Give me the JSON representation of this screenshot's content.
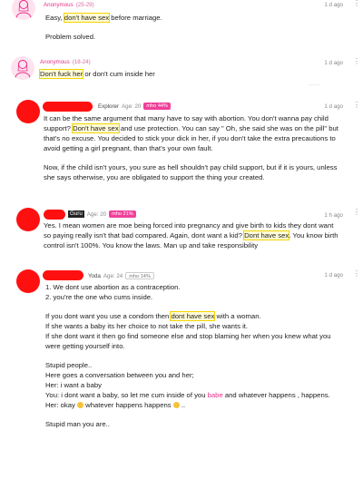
{
  "comments": [
    {
      "author": "Anonymous",
      "age": "(25-29)",
      "time": "1 d ago",
      "line1_pre": "Easy, ",
      "line1_hl": "don't have sex",
      "line1_post": " before marriage.",
      "line2": "Problem solved."
    },
    {
      "author": "Anonymous",
      "age": "(18-24)",
      "time": "1 d ago",
      "line1_hl": "Don't fuck her",
      "line1_post": " or don't cum inside her"
    },
    {
      "rank": "Explorer",
      "age": "Age: 20",
      "badge": "mho 44%",
      "time": "1 d ago",
      "lines": [
        "It can be the same argument that many have to say with abortion. You don't wanna pay child",
        "that's no excuse. You decided to stick your dick in her, if you don't take the extra precautions to",
        "avoid getting a girl pregnant, than that's your own fault.",
        "Now, if the child isn't yours, you sure as hell shouldn't pay child support, but if it is yours, unless",
        "she says otherwise, you are obligated to support the thing your created."
      ],
      "l2_pre": "support? ",
      "l2_hl": "Don't have sex",
      "l2_post": " and use protection. You can say \" Oh, she said she was on the pill\" but"
    },
    {
      "rank": "Guru",
      "age": "Age: 20",
      "badge": "mho 21%",
      "time": "1 h ago",
      "l1": "Yes. I mean women are moe being forced into pregnancy and give birth to kids they dont want",
      "l2_pre": "so paying really isn't that bad compared. Again, dont want a kid? ",
      "l2_hl": "Dont have sex",
      "l2_post": ". You know birth",
      "l3": "control isn't 100%. You know the laws. Man up and take responsibility"
    },
    {
      "rank": "Yoda",
      "age": "Age: 24",
      "badge": "mho 14%",
      "time": "1 d ago",
      "l1": "1. We dont use abortion as a contraception.",
      "l2": "2. you're the one who cums inside.",
      "l3_pre": "If you dont want you use a condom then ",
      "l3_hl": "dont have sex",
      "l3_post": " with a woman.",
      "l4": "If she wants a baby its her choice to not take the pill, she wants it.",
      "l5": "If she dont want it then go find someone else and stop blaming her when you knew what you",
      "l6": "were getting yourself into.",
      "l7": "Stupid people..",
      "l8": "Here goes a conversation between you and her;",
      "l9": "Her: i want a baby",
      "l10_pre": "You: i dont want a baby, so let me cum inside of you ",
      "l10_pink": "babe",
      "l10_post": " and whatever happens , happens.",
      "l11_pre": "Her: okay ",
      "l11_mid": " whatever happens happens ",
      "l11_post": " ..",
      "l12": "Stupid man you are.."
    }
  ]
}
